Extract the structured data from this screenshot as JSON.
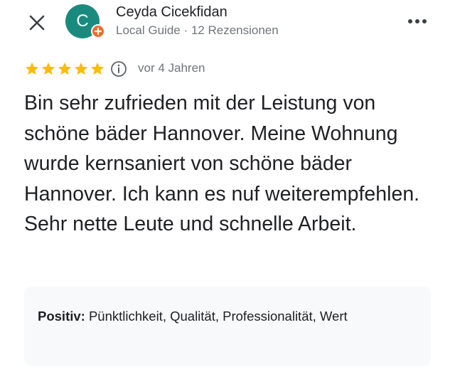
{
  "header": {
    "avatar_initial": "C",
    "user_name": "Ceyda Cicekfidan",
    "user_meta": "Local Guide · 12 Rezensionen",
    "close_icon": "close-icon",
    "more_icon": "more-horizontal-icon"
  },
  "rating": {
    "stars": 5,
    "max_stars": 5,
    "star_color": "#fbbc04",
    "time_ago": "vor 4 Jahren"
  },
  "review": {
    "text": "Bin sehr zufrieden mit der Leistung von schöne bäder Hannover. Meine Wohnung wurde kernsaniert von schöne bäder Hannover. Ich kann es nuf weiterempfehlen. Sehr nette Leute und schnelle Arbeit."
  },
  "attributes": {
    "label": "Positiv:",
    "values": "Pünktlichkeit, Qualität, Professionalität, Wert"
  },
  "colors": {
    "avatar_bg": "#1a8a7e",
    "badge_bg": "#ee6b2e",
    "secondary_text": "#70757a",
    "box_bg": "#f8f9fa"
  }
}
